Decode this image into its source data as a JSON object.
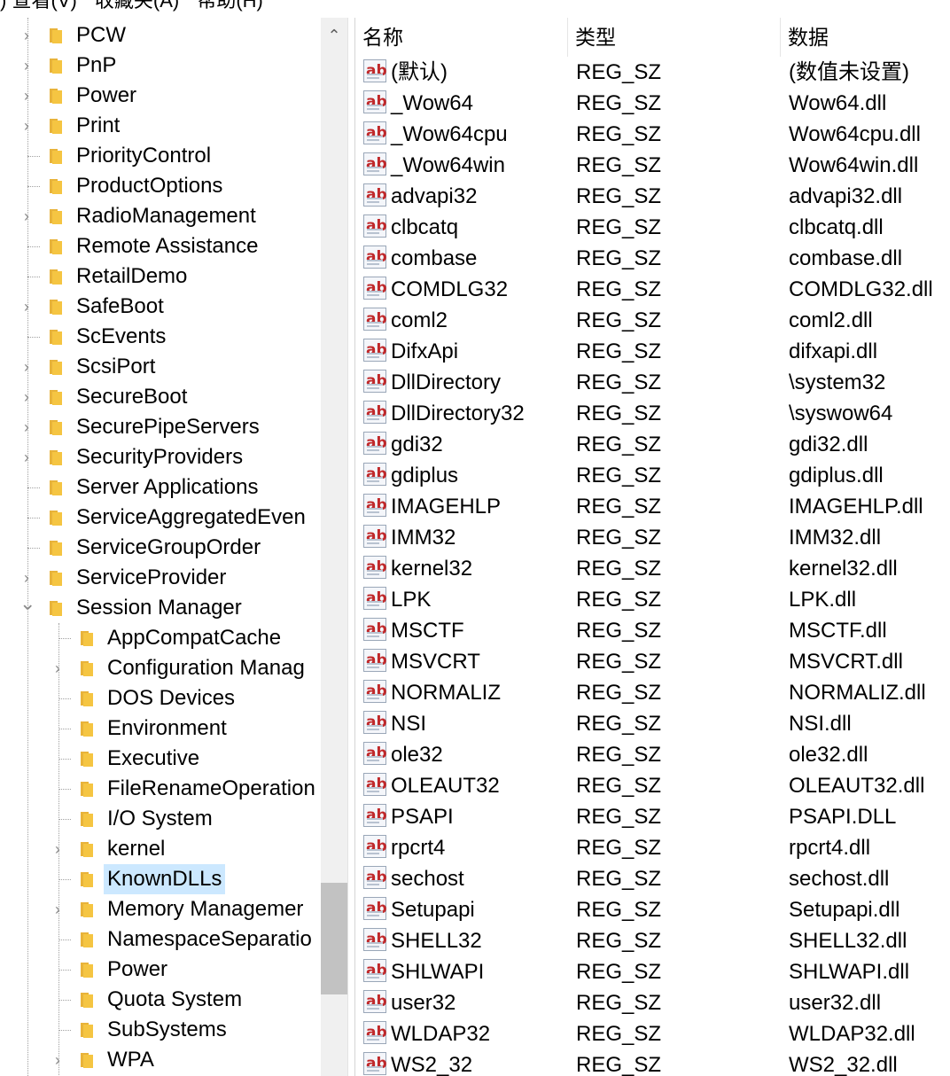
{
  "menu": {
    "view": ") 查看(V)",
    "favorites": "收藏夹(A)",
    "help": "帮助(H)"
  },
  "tree": {
    "items": [
      {
        "label": "PCW",
        "expandable": true,
        "indent": 0
      },
      {
        "label": "PnP",
        "expandable": true,
        "indent": 0
      },
      {
        "label": "Power",
        "expandable": true,
        "indent": 0
      },
      {
        "label": "Print",
        "expandable": true,
        "indent": 0
      },
      {
        "label": "PriorityControl",
        "expandable": false,
        "indent": 0
      },
      {
        "label": "ProductOptions",
        "expandable": false,
        "indent": 0
      },
      {
        "label": "RadioManagement",
        "expandable": true,
        "indent": 0
      },
      {
        "label": "Remote Assistance",
        "expandable": false,
        "indent": 0
      },
      {
        "label": "RetailDemo",
        "expandable": false,
        "indent": 0
      },
      {
        "label": "SafeBoot",
        "expandable": true,
        "indent": 0
      },
      {
        "label": "ScEvents",
        "expandable": false,
        "indent": 0
      },
      {
        "label": "ScsiPort",
        "expandable": true,
        "indent": 0
      },
      {
        "label": "SecureBoot",
        "expandable": true,
        "indent": 0
      },
      {
        "label": "SecurePipeServers",
        "expandable": true,
        "indent": 0
      },
      {
        "label": "SecurityProviders",
        "expandable": true,
        "indent": 0
      },
      {
        "label": "Server Applications",
        "expandable": false,
        "indent": 0
      },
      {
        "label": "ServiceAggregatedEven",
        "expandable": false,
        "indent": 0
      },
      {
        "label": "ServiceGroupOrder",
        "expandable": false,
        "indent": 0
      },
      {
        "label": "ServiceProvider",
        "expandable": true,
        "indent": 0
      },
      {
        "label": "Session Manager",
        "expandable": true,
        "expanded": true,
        "indent": 0
      },
      {
        "label": "AppCompatCache",
        "expandable": false,
        "indent": 1
      },
      {
        "label": "Configuration Manag",
        "expandable": true,
        "indent": 1
      },
      {
        "label": "DOS Devices",
        "expandable": false,
        "indent": 1
      },
      {
        "label": "Environment",
        "expandable": false,
        "indent": 1
      },
      {
        "label": "Executive",
        "expandable": false,
        "indent": 1
      },
      {
        "label": "FileRenameOperation",
        "expandable": false,
        "indent": 1
      },
      {
        "label": "I/O System",
        "expandable": false,
        "indent": 1
      },
      {
        "label": "kernel",
        "expandable": true,
        "indent": 1
      },
      {
        "label": "KnownDLLs",
        "expandable": false,
        "indent": 1,
        "selected": true
      },
      {
        "label": "Memory Managemer",
        "expandable": true,
        "indent": 1
      },
      {
        "label": "NamespaceSeparatio",
        "expandable": false,
        "indent": 1
      },
      {
        "label": "Power",
        "expandable": false,
        "indent": 1
      },
      {
        "label": "Quota System",
        "expandable": false,
        "indent": 1
      },
      {
        "label": "SubSystems",
        "expandable": false,
        "indent": 1
      },
      {
        "label": "WPA",
        "expandable": true,
        "indent": 1
      }
    ]
  },
  "list": {
    "headers": {
      "name": "名称",
      "type": "类型",
      "data": "数据"
    },
    "rows": [
      {
        "name": "(默认)",
        "type": "REG_SZ",
        "data": "(数值未设置)"
      },
      {
        "name": "_Wow64",
        "type": "REG_SZ",
        "data": "Wow64.dll"
      },
      {
        "name": "_Wow64cpu",
        "type": "REG_SZ",
        "data": "Wow64cpu.dll"
      },
      {
        "name": "_Wow64win",
        "type": "REG_SZ",
        "data": "Wow64win.dll"
      },
      {
        "name": "advapi32",
        "type": "REG_SZ",
        "data": "advapi32.dll"
      },
      {
        "name": "clbcatq",
        "type": "REG_SZ",
        "data": "clbcatq.dll"
      },
      {
        "name": "combase",
        "type": "REG_SZ",
        "data": "combase.dll"
      },
      {
        "name": "COMDLG32",
        "type": "REG_SZ",
        "data": "COMDLG32.dll"
      },
      {
        "name": "coml2",
        "type": "REG_SZ",
        "data": "coml2.dll"
      },
      {
        "name": "DifxApi",
        "type": "REG_SZ",
        "data": "difxapi.dll"
      },
      {
        "name": "DllDirectory",
        "type": "REG_SZ",
        "data": "\\system32"
      },
      {
        "name": "DllDirectory32",
        "type": "REG_SZ",
        "data": "\\syswow64"
      },
      {
        "name": "gdi32",
        "type": "REG_SZ",
        "data": "gdi32.dll"
      },
      {
        "name": "gdiplus",
        "type": "REG_SZ",
        "data": "gdiplus.dll"
      },
      {
        "name": "IMAGEHLP",
        "type": "REG_SZ",
        "data": "IMAGEHLP.dll"
      },
      {
        "name": "IMM32",
        "type": "REG_SZ",
        "data": "IMM32.dll"
      },
      {
        "name": "kernel32",
        "type": "REG_SZ",
        "data": "kernel32.dll"
      },
      {
        "name": "LPK",
        "type": "REG_SZ",
        "data": "LPK.dll"
      },
      {
        "name": "MSCTF",
        "type": "REG_SZ",
        "data": "MSCTF.dll"
      },
      {
        "name": "MSVCRT",
        "type": "REG_SZ",
        "data": "MSVCRT.dll"
      },
      {
        "name": "NORMALIZ",
        "type": "REG_SZ",
        "data": "NORMALIZ.dll"
      },
      {
        "name": "NSI",
        "type": "REG_SZ",
        "data": "NSI.dll"
      },
      {
        "name": "ole32",
        "type": "REG_SZ",
        "data": "ole32.dll"
      },
      {
        "name": "OLEAUT32",
        "type": "REG_SZ",
        "data": "OLEAUT32.dll"
      },
      {
        "name": "PSAPI",
        "type": "REG_SZ",
        "data": "PSAPI.DLL"
      },
      {
        "name": "rpcrt4",
        "type": "REG_SZ",
        "data": "rpcrt4.dll"
      },
      {
        "name": "sechost",
        "type": "REG_SZ",
        "data": "sechost.dll"
      },
      {
        "name": "Setupapi",
        "type": "REG_SZ",
        "data": "Setupapi.dll"
      },
      {
        "name": "SHELL32",
        "type": "REG_SZ",
        "data": "SHELL32.dll"
      },
      {
        "name": "SHLWAPI",
        "type": "REG_SZ",
        "data": "SHLWAPI.dll"
      },
      {
        "name": "user32",
        "type": "REG_SZ",
        "data": "user32.dll"
      },
      {
        "name": "WLDAP32",
        "type": "REG_SZ",
        "data": "WLDAP32.dll"
      },
      {
        "name": "WS2_32",
        "type": "REG_SZ",
        "data": "WS2_32.dll"
      }
    ]
  },
  "colors": {
    "selection": "#cce8ff",
    "folder": "#f5c542",
    "ab_icon_text": "#c0282a"
  }
}
